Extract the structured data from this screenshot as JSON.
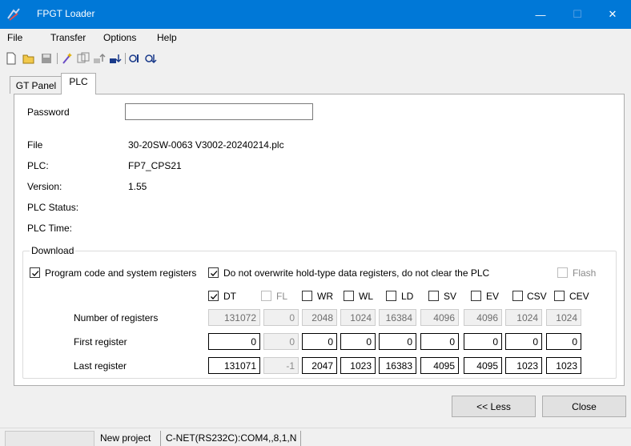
{
  "window": {
    "title": "FPGT Loader",
    "minimize": "—",
    "maximize": "☐",
    "close": "✕"
  },
  "menu": [
    "File",
    "Transfer",
    "Options",
    "Help"
  ],
  "toolbar_icons": [
    "new-icon",
    "open-icon",
    "save-icon",
    "wand-icon",
    "compare-icon",
    "upload-icon",
    "download-icon",
    "read-plc-icon",
    "write-plc-icon"
  ],
  "tabs": [
    {
      "label": "GT Panel",
      "active": false
    },
    {
      "label": "PLC",
      "active": true
    }
  ],
  "plc": {
    "password_label": "Password",
    "password_value": "",
    "file_label": "File",
    "file_value": "30-20SW-0063 V3002-20240214.plc",
    "plc_label": "PLC:",
    "plc_value": "FP7_CPS21",
    "version_label": "Version:",
    "version_value": "1.55",
    "status_label": "PLC Status:",
    "status_value": "",
    "time_label": "PLC Time:",
    "time_value": ""
  },
  "download": {
    "title": "Download",
    "program_code": {
      "label": "Program code and system registers",
      "checked": true
    },
    "no_overwrite": {
      "label": "Do not overwrite hold-type data registers, do not clear the PLC",
      "checked": true
    },
    "flash": {
      "label": "Flash",
      "checked": false,
      "disabled": true
    },
    "row_labels": {
      "count": "Number of registers",
      "first": "First register",
      "last": "Last register"
    },
    "columns": [
      {
        "name": "DT",
        "checked": true,
        "disabled": false,
        "count": "131072",
        "first": "0",
        "last": "131071"
      },
      {
        "name": "FL",
        "checked": false,
        "disabled": true,
        "count": "0",
        "first": "0",
        "last": "-1"
      },
      {
        "name": "WR",
        "checked": false,
        "disabled": false,
        "count": "2048",
        "first": "0",
        "last": "2047"
      },
      {
        "name": "WL",
        "checked": false,
        "disabled": false,
        "count": "1024",
        "first": "0",
        "last": "1023"
      },
      {
        "name": "LD",
        "checked": false,
        "disabled": false,
        "count": "16384",
        "first": "0",
        "last": "16383"
      },
      {
        "name": "SV",
        "checked": false,
        "disabled": false,
        "count": "4096",
        "first": "0",
        "last": "4095"
      },
      {
        "name": "EV",
        "checked": false,
        "disabled": false,
        "count": "4096",
        "first": "0",
        "last": "4095"
      },
      {
        "name": "CSV",
        "checked": false,
        "disabled": false,
        "count": "1024",
        "first": "0",
        "last": "1023"
      },
      {
        "name": "CEV",
        "checked": false,
        "disabled": false,
        "count": "1024",
        "first": "0",
        "last": "1023"
      }
    ]
  },
  "buttons": {
    "less": "<< Less",
    "close": "Close"
  },
  "status": {
    "pane1": "",
    "project": "New project",
    "connection": "C-NET(RS232C):COM4,,8,1,N"
  },
  "colors": {
    "titlebar": "#0078d7",
    "accent": "#0078d7"
  }
}
